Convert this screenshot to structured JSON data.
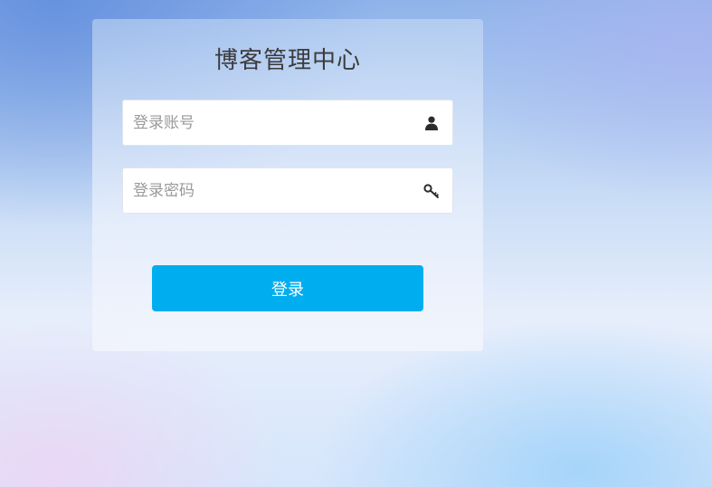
{
  "login_panel": {
    "title": "博客管理中心",
    "username": {
      "placeholder": "登录账号",
      "value": "",
      "icon": "user-icon"
    },
    "password": {
      "placeholder": "登录密码",
      "value": "",
      "icon": "key-icon"
    },
    "login_button_label": "登录"
  },
  "colors": {
    "button": "#00aeef",
    "title_text": "#3b3b3b",
    "placeholder_text": "#9a9a9a"
  }
}
